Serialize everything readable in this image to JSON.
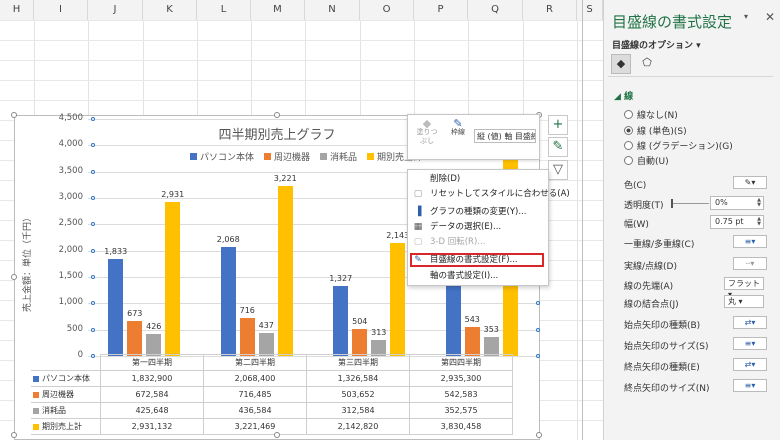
{
  "sheet": {
    "columns": [
      "H",
      "I",
      "J",
      "K",
      "L",
      "M",
      "N",
      "O",
      "P",
      "Q",
      "R",
      "S"
    ]
  },
  "colors": {
    "pc": "#4472C4",
    "peripheral": "#ED7D31",
    "consumable": "#A5A5A5",
    "total": "#FFC000",
    "accent": "#217346",
    "highlight": "#D9262B"
  },
  "chart_data": {
    "type": "bar",
    "title": "四半期別売上グラフ",
    "ylabel": "売上金額：単位（千円）",
    "categories": [
      "第一四半期",
      "第二四半期",
      "第三四半期",
      "第四四半期"
    ],
    "ylim": [
      0,
      4500
    ],
    "yticks": [
      "0",
      "500",
      "1,000",
      "1,500",
      "2,000",
      "2,500",
      "3,000",
      "3,500",
      "4,000",
      "4,500"
    ],
    "series": [
      {
        "name": "パソコン本体",
        "values": [
          1833,
          2068,
          1327,
          2935
        ],
        "labels": [
          "1,833",
          "2,068",
          "1,327",
          ""
        ]
      },
      {
        "name": "周辺機器",
        "values": [
          673,
          716,
          504,
          543
        ],
        "labels": [
          "673",
          "716",
          "504",
          "543"
        ]
      },
      {
        "name": "消耗品",
        "values": [
          426,
          437,
          313,
          353
        ],
        "labels": [
          "426",
          "437",
          "313",
          "353"
        ]
      },
      {
        "name": "期別売上計",
        "values": [
          2931,
          3221,
          2143,
          3831
        ],
        "labels": [
          "2,931",
          "3,221",
          "2,143",
          ""
        ]
      }
    ],
    "table": [
      [
        "1,832,900",
        "2,068,400",
        "1,326,584",
        "2,935,300"
      ],
      [
        "672,584",
        "716,485",
        "503,652",
        "542,583"
      ],
      [
        "425,648",
        "436,584",
        "312,584",
        "352,575"
      ],
      [
        "2,931,132",
        "3,221,469",
        "2,142,820",
        "3,830,458"
      ]
    ],
    "legend_position": "top"
  },
  "mini_toolbar": {
    "fill_label": "塗りつぶし",
    "outline_label": "枠線",
    "element_select": "縦 (値) 軸 目盛線"
  },
  "context_menu": [
    {
      "label": "削除(D)",
      "icon": "delete-icon",
      "enabled": true
    },
    {
      "label": "リセットしてスタイルに合わせる(A)",
      "icon": "reset-icon",
      "enabled": true
    },
    {
      "label": "グラフの種類の変更(Y)...",
      "icon": "chart-type-icon",
      "enabled": true
    },
    {
      "label": "データの選択(E)...",
      "icon": "data-select-icon",
      "enabled": true
    },
    {
      "label": "3-D 回転(R)...",
      "icon": "rotate-3d-icon",
      "enabled": false
    },
    {
      "label": "目盛線の書式設定(F)...",
      "icon": "format-gridline-icon",
      "enabled": true
    },
    {
      "label": "軸の書式設定(I)...",
      "icon": "",
      "enabled": true
    }
  ],
  "pane": {
    "title": "目盛線の書式設定",
    "options_label": "目盛線のオプション",
    "section": "線",
    "radios": [
      "線なし(N)",
      "線 (単色)(S)",
      "線 (グラデーション)(G)",
      "自動(U)"
    ],
    "color_label": "色(C)",
    "transparency_label": "透明度(T)",
    "transparency_value": "0%",
    "width_label": "幅(W)",
    "width_value": "0.75 pt",
    "compound_label": "一重線/多重線(C)",
    "dash_label": "実線/点線(D)",
    "cap_label": "線の先端(A)",
    "cap_value": "フラット",
    "join_label": "線の結合点(J)",
    "join_value": "丸",
    "begin_arrow_type": "始点矢印の種類(B)",
    "begin_arrow_size": "始点矢印のサイズ(S)",
    "end_arrow_type": "終点矢印の種類(E)",
    "end_arrow_size": "終点矢印のサイズ(N)"
  }
}
